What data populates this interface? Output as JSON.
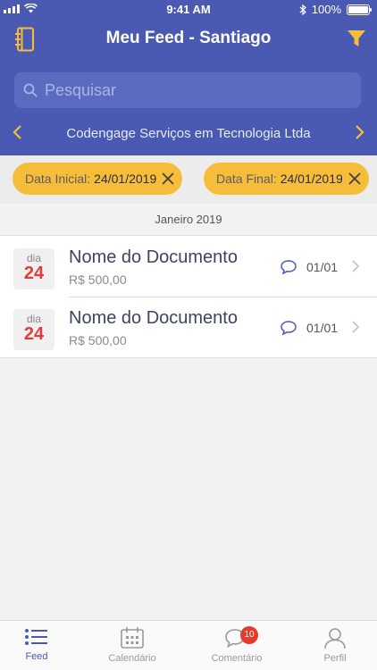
{
  "status_bar": {
    "time": "9:41 AM",
    "battery": "100%"
  },
  "header": {
    "title": "Meu Feed - Santiago",
    "search_placeholder": "Pesquisar",
    "company": "Codengage Serviços em Tecnologia Ltda",
    "background": "#4a5ab3",
    "accent": "#f6bd3a"
  },
  "filters": [
    {
      "label": "Data Inicial:",
      "value": "24/01/2019"
    },
    {
      "label": "Data Final:",
      "value": "24/01/2019"
    }
  ],
  "month": "Janeiro 2019",
  "documents": [
    {
      "day_label": "dia",
      "day": "24",
      "title": "Nome do Documento",
      "amount": "R$ 500,00",
      "comments": "01/01"
    },
    {
      "day_label": "dia",
      "day": "24",
      "title": "Nome do Documento",
      "amount": "R$ 500,00",
      "comments": "01/01"
    }
  ],
  "tabs": [
    {
      "label": "Feed",
      "active": true
    },
    {
      "label": "Calendário",
      "active": false
    },
    {
      "label": "Comentário",
      "active": false,
      "badge": "10"
    },
    {
      "label": "Perfil",
      "active": false
    }
  ]
}
